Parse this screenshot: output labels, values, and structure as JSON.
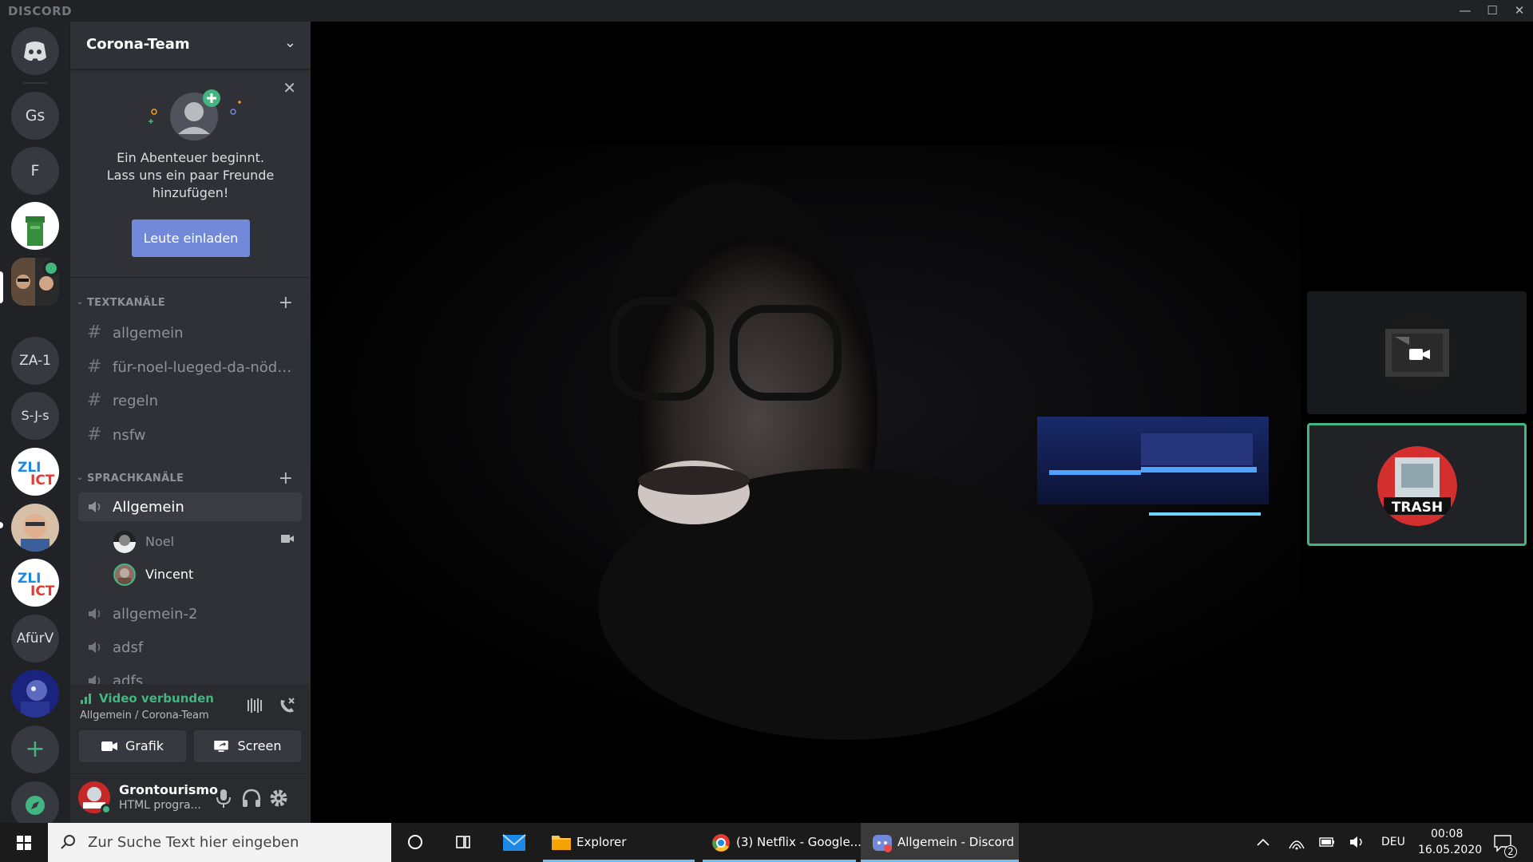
{
  "window": {
    "brand": "DISCORD",
    "controls": {
      "minimize": "—",
      "maximize": "☐",
      "close": "✕"
    }
  },
  "servers": [
    {
      "label": "",
      "icon": "discord-home-icon"
    },
    {
      "label": "Gs"
    },
    {
      "label": "F"
    },
    {
      "label": "",
      "icon": "green-bin-server-icon"
    },
    {
      "label": "",
      "icon": "corona-team-server-icon",
      "selected": true
    },
    {
      "label": "ZA-1"
    },
    {
      "label": "S-J-s"
    },
    {
      "label": "ZLI ICT",
      "icon": "zli-ict-logo-icon"
    },
    {
      "label": "",
      "icon": "person-avatar-server-icon"
    },
    {
      "label": "ZLI ICT",
      "icon": "zli-ict-logo-icon"
    },
    {
      "label": "AfürV"
    },
    {
      "label": "",
      "icon": "game-character-server-icon"
    }
  ],
  "rail_actions": {
    "add": "+",
    "explore": "compass-icon"
  },
  "guild": {
    "name": "Corona-Team"
  },
  "invite": {
    "line1": "Ein Abenteuer beginnt.",
    "line2": "Lass uns ein paar Freunde",
    "line3": "hinzufügen!",
    "button": "Leute einladen"
  },
  "text_category": {
    "label": "TEXTKANÄLE"
  },
  "text_channels": [
    {
      "name": "allgemein"
    },
    {
      "name": "für-noel-lueged-da-nöd-i..."
    },
    {
      "name": "regeln"
    },
    {
      "name": "nsfw"
    }
  ],
  "voice_category": {
    "label": "SPRACHKANÄLE"
  },
  "voice_channels": [
    {
      "name": "Allgemein",
      "active": true
    },
    {
      "name": "allgemein-2"
    },
    {
      "name": "adsf"
    },
    {
      "name": "adfs"
    }
  ],
  "voice_members": [
    {
      "name": "Noel",
      "video": true
    },
    {
      "name": "Vincent",
      "speaking": true
    }
  ],
  "voice_panel": {
    "status": "Video verbunden",
    "sub": "Allgemein / Corona-Team",
    "btn_video": "Grafik",
    "btn_screen": "Screen"
  },
  "user": {
    "name": "Grontourismo",
    "status": "HTML progra..."
  },
  "tiles": [
    {
      "name": "camera-off-tile",
      "speaking": false
    },
    {
      "name": "trash-avatar-tile",
      "speaking": true,
      "avatar_text": "TRASH"
    }
  ],
  "taskbar": {
    "search_placeholder": "Zur Suche Text hier eingeben",
    "apps": [
      {
        "label": "Explorer"
      },
      {
        "label": "(3) Netflix - Google..."
      },
      {
        "label": "Allgemein - Discord",
        "active": true
      }
    ],
    "lang": "DEU",
    "time": "00:08",
    "date": "16.05.2020",
    "notifications": "2"
  },
  "colors": {
    "accent": "#7289da",
    "online": "#43b581",
    "rail_bg": "#202225",
    "sidebar_bg": "#2f3136",
    "panel_bg": "#292b2f"
  }
}
